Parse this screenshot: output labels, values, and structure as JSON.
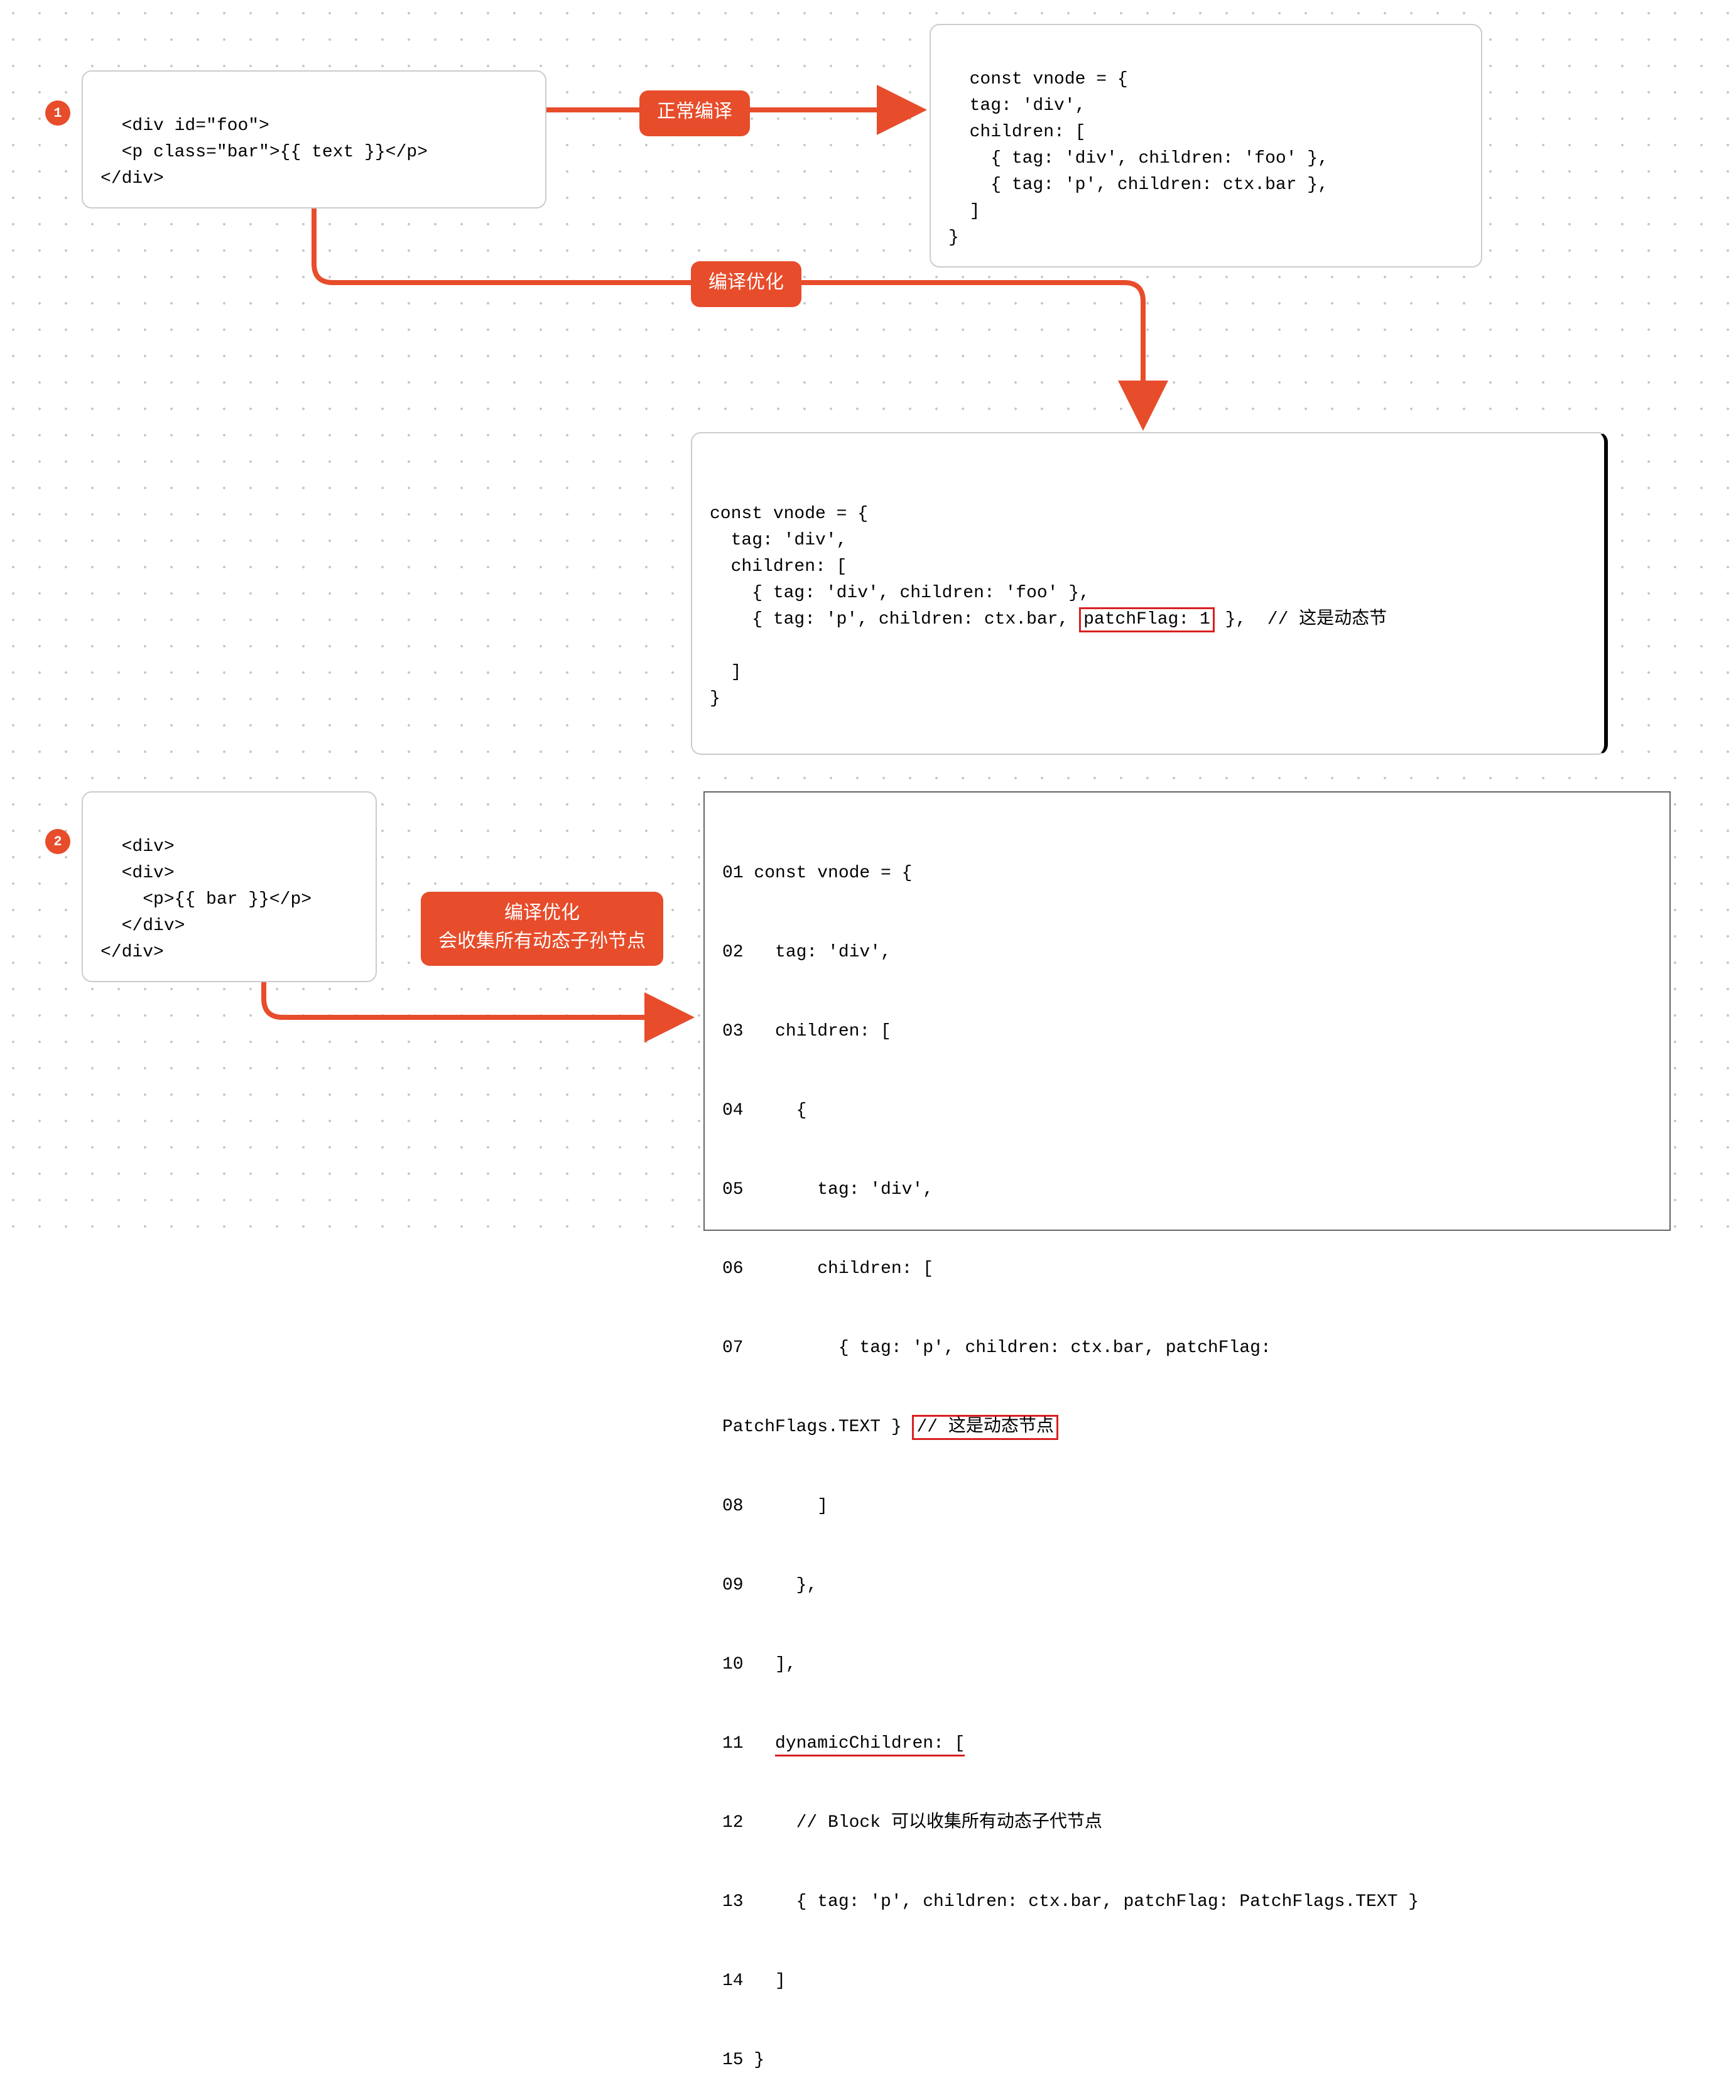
{
  "badges": {
    "one": "1",
    "two": "2"
  },
  "labels": {
    "normalCompile": "正常编译",
    "compileOpt": "编译优化",
    "compileOptCollect": "编译优化\n会收集所有动态子孙节点"
  },
  "box1_source": "<div id=\"foo\">\n  <p class=\"bar\">{{ text }}</p>\n</div>",
  "box1_normal": "const vnode = {\n  tag: 'div',\n  children: [\n    { tag: 'div', children: 'foo' },\n    { tag: 'p', children: ctx.bar },\n  ]\n}",
  "box1_opt": {
    "pre": "const vnode = {\n  tag: 'div',\n  children: [\n    { tag: 'div', children: 'foo' },\n    { tag: 'p', children: ctx.bar,",
    "hl": "patchFlag: 1",
    "post": "},  // 这是动态节\n\n  ]\n}"
  },
  "box2_source": "<div>\n  <div>\n    <p>{{ bar }}</p>\n  </div>\n</div>",
  "box2_opt": {
    "l01": "01 const vnode = {",
    "l02": "02   tag: 'div',",
    "l03": "03   children: [",
    "l04": "04     {",
    "l05": "05       tag: 'div',",
    "l06": "06       children: [",
    "l07a": "07         { tag: 'p', children: ctx.bar, patchFlag:",
    "l07b": "PatchFlags.TEXT }",
    "l07hl": "// 这是动态节点",
    "l08": "08       ]",
    "l09": "09     },",
    "l10": "10   ],",
    "l11a": "11   ",
    "l11ul": "dynamicChildren: [",
    "l12": "12     // Block 可以收集所有动态子代节点",
    "l13": "13     { tag: 'p', children: ctx.bar, patchFlag: PatchFlags.TEXT }",
    "l14": "14   ]",
    "l15": "15 }"
  }
}
